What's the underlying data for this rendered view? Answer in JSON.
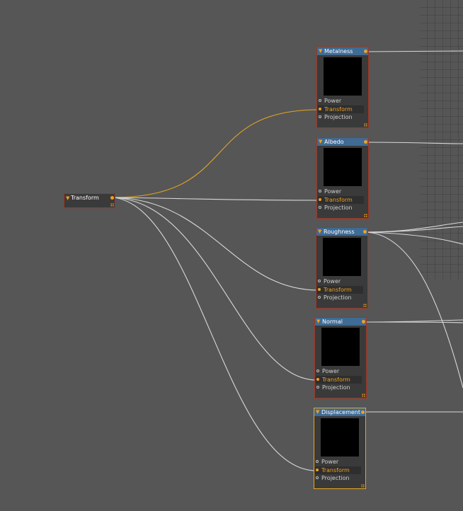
{
  "colors": {
    "background": "#565656",
    "node_body": "#3a3a3a",
    "node_header": "#3f6b95",
    "node_border": "#a8321e",
    "selected_border": "#e6a520",
    "active_wire": "#e6a520",
    "wire": "#d8d8d8",
    "port_accent": "#f0a020"
  },
  "transform_node": {
    "title": "Transform"
  },
  "texture_nodes": [
    {
      "title": "Metalness",
      "inputs": [
        "Power",
        "Transform",
        "Projection"
      ],
      "active_input": "Transform",
      "selected": false
    },
    {
      "title": "Albedo",
      "inputs": [
        "Power",
        "Transform",
        "Projection"
      ],
      "active_input": "Transform",
      "selected": false
    },
    {
      "title": "Roughness",
      "inputs": [
        "Power",
        "Transform",
        "Projection"
      ],
      "active_input": "Transform",
      "selected": false
    },
    {
      "title": "Normal",
      "inputs": [
        "Power",
        "Transform",
        "Projection"
      ],
      "active_input": "Transform",
      "selected": false
    },
    {
      "title": "Displacement",
      "inputs": [
        "Power",
        "Transform",
        "Projection"
      ],
      "active_input": "Transform",
      "selected": true
    }
  ],
  "icons": {
    "collapse": "triangle-down-icon",
    "output_port": "output-port-icon",
    "input_port": "input-port-icon",
    "resize": "resize-grip-icon"
  }
}
